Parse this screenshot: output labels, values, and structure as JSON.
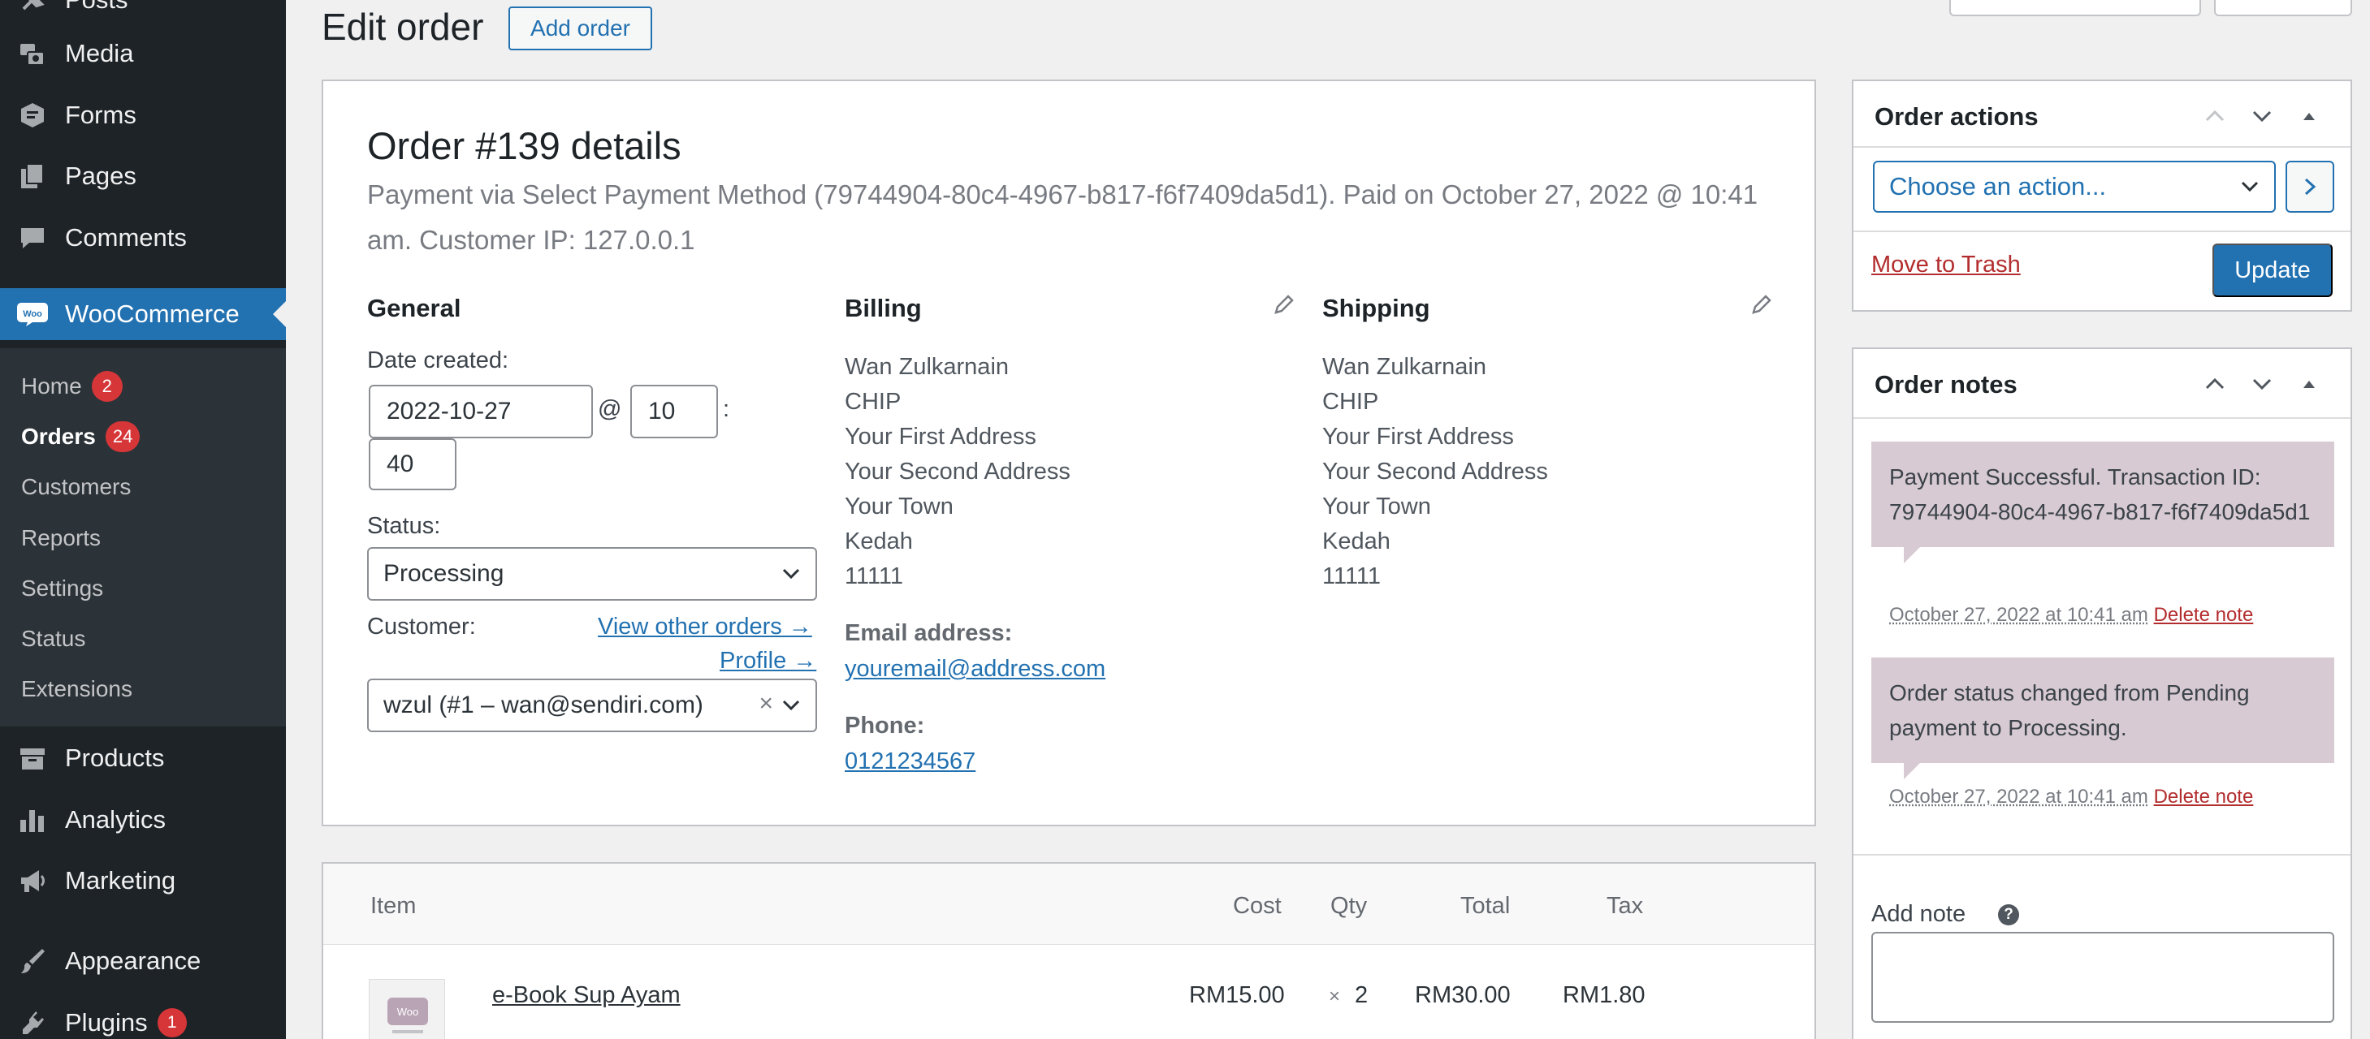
{
  "sidebar": {
    "menu": [
      {
        "label": "Posts",
        "icon": "pin-icon"
      },
      {
        "label": "Media",
        "icon": "media-icon"
      },
      {
        "label": "Forms",
        "icon": "forms-icon"
      },
      {
        "label": "Pages",
        "icon": "pages-icon"
      },
      {
        "label": "Comments",
        "icon": "comments-icon"
      },
      {
        "label": "WooCommerce",
        "icon": "woocommerce-icon"
      },
      {
        "label": "Products",
        "icon": "products-icon"
      },
      {
        "label": "Analytics",
        "icon": "analytics-icon"
      },
      {
        "label": "Marketing",
        "icon": "marketing-icon"
      },
      {
        "label": "Appearance",
        "icon": "appearance-icon"
      },
      {
        "label": "Plugins",
        "icon": "plugins-icon",
        "badge": "1"
      }
    ],
    "submenu": [
      {
        "label": "Home",
        "badge": "2"
      },
      {
        "label": "Orders",
        "badge": "24",
        "active": true
      },
      {
        "label": "Customers"
      },
      {
        "label": "Reports"
      },
      {
        "label": "Settings"
      },
      {
        "label": "Status"
      },
      {
        "label": "Extensions"
      }
    ]
  },
  "header": {
    "title": "Edit order",
    "add_order_label": "Add order"
  },
  "order": {
    "heading": "Order #139 details",
    "meta": "Payment via Select Payment Method (79744904-80c4-4967-b817-f6f7409da5d1). Paid on October 27, 2022 @ 10:41 am. Customer IP: 127.0.0.1",
    "general": {
      "heading": "General",
      "date_label": "Date created:",
      "date": "2022-10-27",
      "at": "@",
      "hour": "10",
      "colon": ":",
      "minute": "40",
      "status_label": "Status:",
      "status": "Processing",
      "customer_label": "Customer:",
      "view_other_orders": "View other orders →",
      "profile": "Profile →",
      "customer": "wzul (#1 – wan@sendiri.com)",
      "clear": "×"
    },
    "billing": {
      "heading": "Billing",
      "lines": [
        "Wan Zulkarnain",
        "CHIP",
        "Your First Address",
        "Your Second Address",
        "Your Town",
        "Kedah",
        "11111"
      ],
      "email_label": "Email address:",
      "email": "youremail@address.com",
      "phone_label": "Phone:",
      "phone": "0121234567"
    },
    "shipping": {
      "heading": "Shipping",
      "lines": [
        "Wan Zulkarnain",
        "CHIP",
        "Your First Address",
        "Your Second Address",
        "Your Town",
        "Kedah",
        "11111"
      ]
    }
  },
  "items": {
    "columns": {
      "item": "Item",
      "cost": "Cost",
      "qty": "Qty",
      "total": "Total",
      "tax": "Tax"
    },
    "rows": [
      {
        "name": "e-Book Sup Ayam",
        "cost": "RM15.00",
        "times": "×",
        "qty": "2",
        "total": "RM30.00",
        "tax": "RM1.80"
      }
    ]
  },
  "order_actions": {
    "title": "Order actions",
    "select_value": "Choose an action...",
    "move_to_trash": "Move to Trash",
    "update": "Update"
  },
  "order_notes": {
    "title": "Order notes",
    "notes": [
      {
        "text": "Payment Successful. Transaction ID: 79744904-80c4-4967-b817-f6f7409da5d1",
        "date": "October 27, 2022 at 10:41 am",
        "delete": "Delete note"
      },
      {
        "text": "Order status changed from Pending payment to Processing.",
        "date": "October 27, 2022 at 10:41 am",
        "delete": "Delete note"
      }
    ],
    "add_note_label": "Add note",
    "help": "?"
  },
  "colors": {
    "sidebar_bg": "#1d2327",
    "submenu_bg": "#2c3338",
    "accent": "#2271b1",
    "badge": "#d63638",
    "note_bg": "#d7cad2",
    "danger_link": "#b32d2e"
  }
}
